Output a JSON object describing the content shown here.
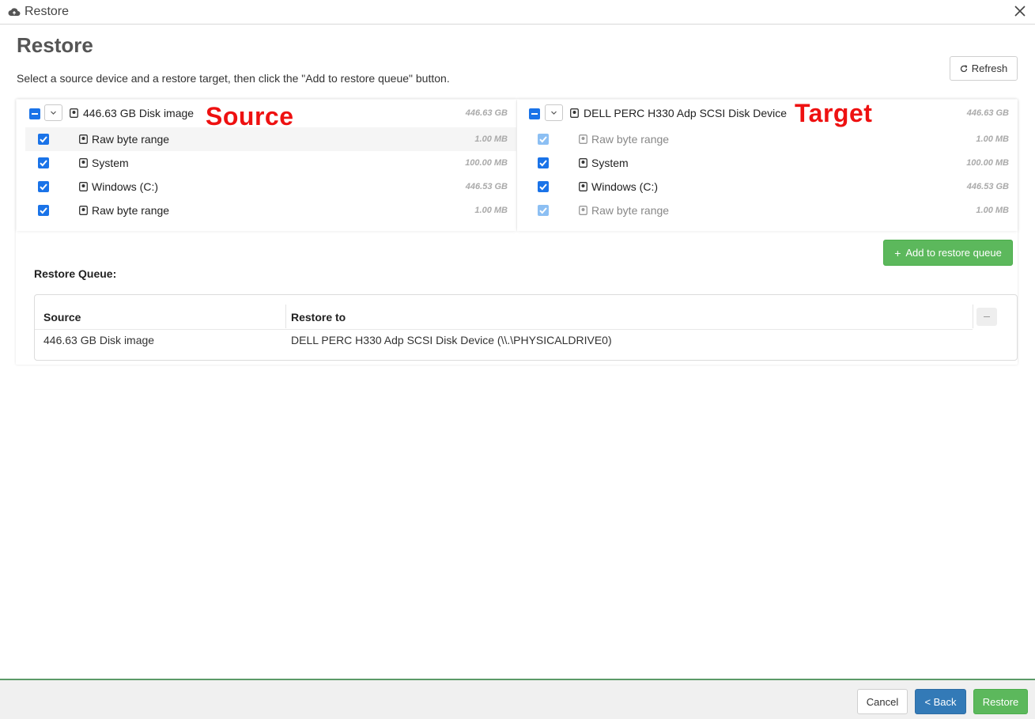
{
  "window": {
    "title": "Restore",
    "close_icon": "close-icon",
    "title_icon": "cloud-icon"
  },
  "header": {
    "title": "Restore",
    "instructions": "Select a source device and a restore target, then click the \"Add to restore queue\" button.",
    "refresh_label": "Refresh"
  },
  "source": {
    "annotation": "Source",
    "device": {
      "label": "446.63 GB Disk image",
      "size": "446.63 GB",
      "checked": "partial"
    },
    "partitions": [
      {
        "label": "Raw byte range",
        "size": "1.00 MB",
        "checked": true
      },
      {
        "label": "System",
        "size": "100.00 MB",
        "checked": true
      },
      {
        "label": "Windows (C:)",
        "size": "446.53 GB",
        "checked": true
      },
      {
        "label": "Raw byte range",
        "size": "1.00 MB",
        "checked": true
      }
    ]
  },
  "target": {
    "annotation": "Target",
    "device": {
      "label": "DELL PERC H330 Adp SCSI Disk Device",
      "size": "446.63 GB",
      "checked": "partial"
    },
    "partitions": [
      {
        "label": "Raw byte range",
        "size": "1.00 MB",
        "checked": true,
        "disabled": true
      },
      {
        "label": "System",
        "size": "100.00 MB",
        "checked": true
      },
      {
        "label": "Windows (C:)",
        "size": "446.53 GB",
        "checked": true
      },
      {
        "label": "Raw byte range",
        "size": "1.00 MB",
        "checked": true,
        "disabled": true
      }
    ]
  },
  "queue": {
    "add_label": "Add to restore queue",
    "title": "Restore Queue:",
    "columns": [
      "Source",
      "Restore to"
    ],
    "rows": [
      {
        "source": "446.63 GB Disk image",
        "restore_to": "DELL PERC H330 Adp SCSI Disk Device (\\\\.\\PHYSICALDRIVE0)"
      }
    ]
  },
  "footer": {
    "cancel_label": "Cancel",
    "back_label": "< Back",
    "restore_label": "Restore"
  },
  "colors": {
    "accent_blue": "#1a73e8",
    "success_green": "#5cb85c",
    "primary_blue": "#337ab7",
    "annotation_red": "#ee1111"
  }
}
